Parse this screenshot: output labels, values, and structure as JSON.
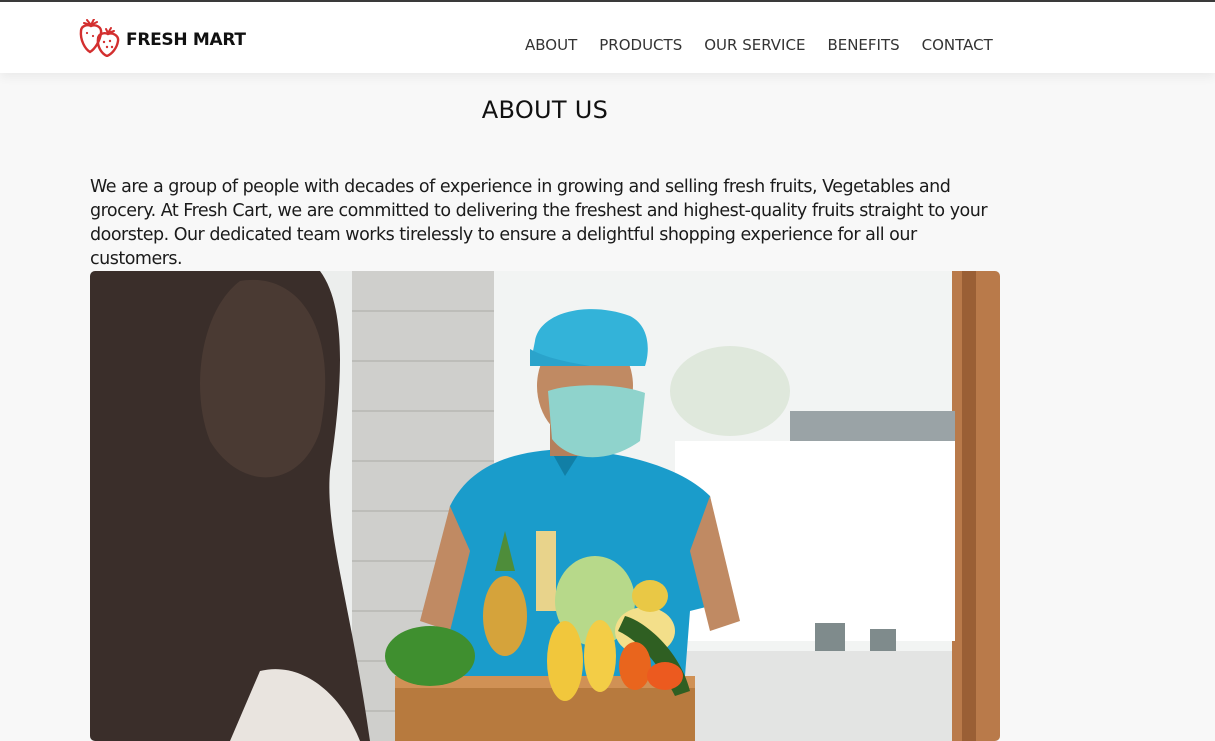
{
  "header": {
    "brand": "FRESH MART",
    "nav": [
      "ABOUT",
      "PRODUCTS",
      "OUR SERVICE",
      "BENEFITS",
      "CONTACT"
    ]
  },
  "about": {
    "title": "ABOUT US",
    "paragraph": "We are a group of people with decades of experience in growing and selling fresh fruits, Vegetables and grocery. At Fresh Cart, we are committed to delivering the freshest and highest-quality fruits straight to your doorstep. Our dedicated team works tirelessly to ensure a delightful shopping experience for all our customers."
  },
  "colors": {
    "brand_red": "#d32f2f",
    "background": "#f8f8f8",
    "header_bg": "#ffffff"
  },
  "icons": {
    "logo": "strawberry-icon"
  }
}
